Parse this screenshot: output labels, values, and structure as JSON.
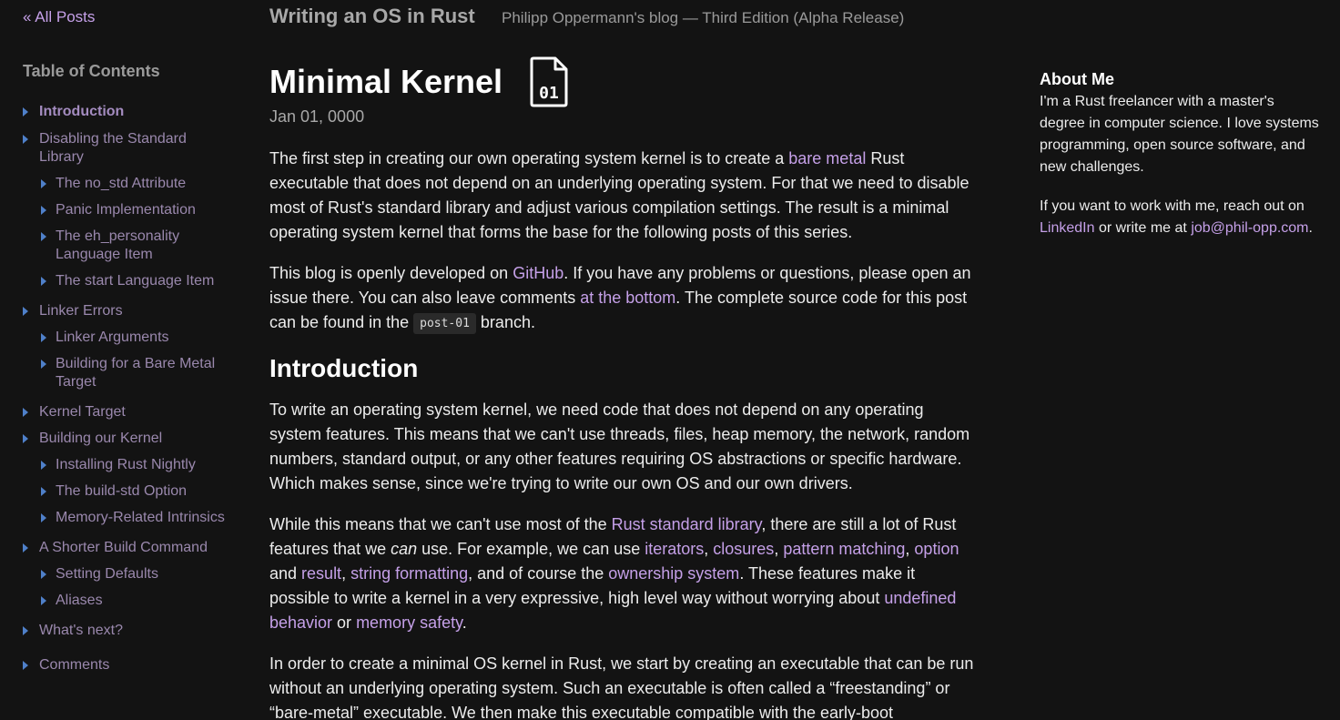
{
  "sidebar": {
    "all_posts": "« All Posts",
    "toc_title": "Table of Contents",
    "toc": [
      {
        "label": "Introduction",
        "active": true,
        "children": []
      },
      {
        "label": "Disabling the Standard Library",
        "children": [
          {
            "label": "The no_std Attribute"
          },
          {
            "label": "Panic Implementation"
          },
          {
            "label": "The eh_personality Language Item"
          },
          {
            "label": "The start Language Item"
          }
        ]
      },
      {
        "label": "Linker Errors",
        "children": [
          {
            "label": "Linker Arguments"
          },
          {
            "label": "Building for a Bare Metal Target"
          }
        ]
      },
      {
        "label": "Kernel Target",
        "children": []
      },
      {
        "label": "Building our Kernel",
        "children": [
          {
            "label": "Installing Rust Nightly"
          },
          {
            "label": "The build-std Option"
          },
          {
            "label": "Memory-Related Intrinsics"
          }
        ]
      },
      {
        "label": "A Shorter Build Command",
        "children": [
          {
            "label": "Setting Defaults"
          },
          {
            "label": "Aliases"
          }
        ]
      },
      {
        "label": "What's next?",
        "children": []
      },
      {
        "label": "Comments",
        "children": []
      }
    ]
  },
  "header": {
    "site_title": "Writing an OS in Rust",
    "subtitle": "Philipp Oppermann's blog — Third Edition (Alpha Release)"
  },
  "post": {
    "title": "Minimal Kernel",
    "icon_label": "01",
    "date": "Jan 01, 0000",
    "p1": {
      "t1": "The first step in creating our own operating system kernel is to create a ",
      "link1": "bare metal",
      "t2": " Rust executable that does not depend on an underlying operating system. For that we need to disable most of Rust's standard library and adjust various compilation settings. The result is a minimal operating system kernel that forms the base for the following posts of this series."
    },
    "p2": {
      "t1": "This blog is openly developed on ",
      "link1": "GitHub",
      "t2": ". If you have any problems or questions, please open an issue there. You can also leave comments ",
      "link2": "at the bottom",
      "t3": ". The complete source code for this post can be found in the ",
      "code": "post-01",
      "t4": " branch."
    },
    "h_intro": "Introduction",
    "p3": "To write an operating system kernel, we need code that does not depend on any operating system features. This means that we can't use threads, files, heap memory, the network, random numbers, standard output, or any other features requiring OS abstractions or specific hardware. Which makes sense, since we're trying to write our own OS and our own drivers.",
    "p4": {
      "t1": "While this means that we can't use most of the ",
      "link_std": "Rust standard library",
      "t2": ", there are still a lot of Rust features that we ",
      "em": "can",
      "t3": " use. For example, we can use ",
      "link_iter": "iterators",
      "sep1": ", ",
      "link_clos": "closures",
      "sep2": ", ",
      "link_pat": "pattern matching",
      "sep3": ", ",
      "link_opt": "option",
      "and": " and ",
      "link_res": "result",
      "sep4": ", ",
      "link_fmt": "string formatting",
      "t4": ", and of course the ",
      "link_own": "ownership system",
      "t5": ". These features make it possible to write a kernel in a very expressive, high level way without worrying about ",
      "link_ub": "undefined behavior",
      "or": " or ",
      "link_mem": "memory safety",
      "end": "."
    },
    "p5": "In order to create a minimal OS kernel in Rust, we start by creating an executable that can be run without an underlying operating system. Such an executable is often called a “freestanding” or “bare-metal” executable. We then make this executable compatible with the early-boot"
  },
  "aside": {
    "title": "About Me",
    "p1": "I'm a Rust freelancer with a master's degree in computer science. I love systems programming, open source software, and new challenges.",
    "p2_t1": "If you want to work with me, reach out on ",
    "linkedin": "LinkedIn",
    "p2_t2": " or write me at ",
    "email": "job@phil-opp.com",
    "p2_t3": "."
  },
  "colors": {
    "background": "#131313",
    "link": "#c5a0e8",
    "toc_link": "#9a88ad",
    "toc_marker": "#4f80c9"
  }
}
